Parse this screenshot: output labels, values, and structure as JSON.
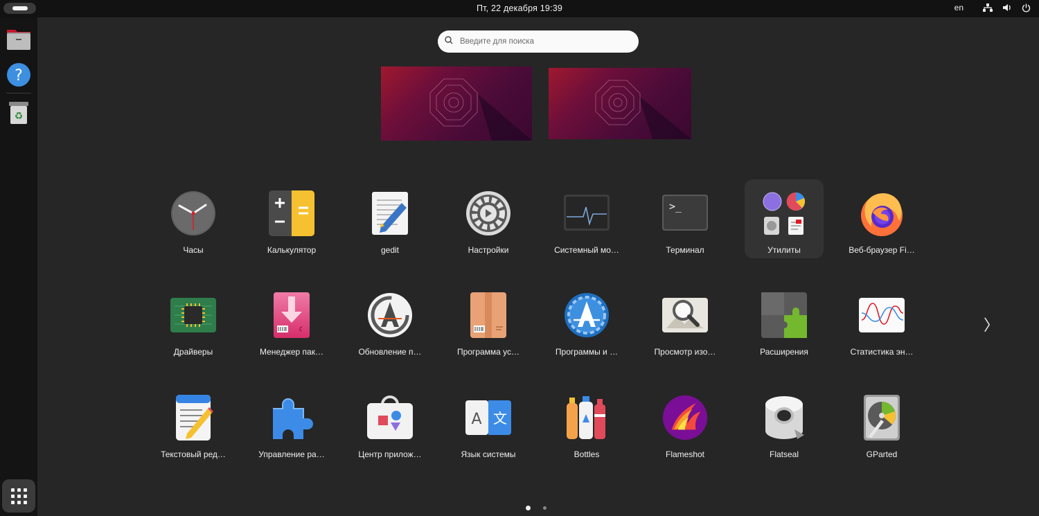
{
  "topbar": {
    "datetime": "Пт, 22 декабря  19:39",
    "lang": "en"
  },
  "search": {
    "placeholder": "Введите для поиска"
  },
  "apps": [
    {
      "label": "Часы",
      "icon": "clock-icon"
    },
    {
      "label": "Калькулятор",
      "icon": "calculator-icon"
    },
    {
      "label": "gedit",
      "icon": "gedit-icon"
    },
    {
      "label": "Настройки",
      "icon": "settings-gear-icon"
    },
    {
      "label": "Системный мо…",
      "icon": "system-monitor-icon"
    },
    {
      "label": "Терминал",
      "icon": "terminal-icon"
    },
    {
      "label": "Утилиты",
      "icon": "utilities-folder-icon"
    },
    {
      "label": "Веб-браузер Fi…",
      "icon": "firefox-icon"
    },
    {
      "label": "Драйверы",
      "icon": "drivers-chip-icon"
    },
    {
      "label": "Менеджер пак…",
      "icon": "package-manager-icon"
    },
    {
      "label": "Обновление п…",
      "icon": "software-updater-icon"
    },
    {
      "label": "Программа ус…",
      "icon": "package-installer-icon"
    },
    {
      "label": "Программы и …",
      "icon": "software-sources-icon"
    },
    {
      "label": "Просмотр изо…",
      "icon": "image-viewer-icon"
    },
    {
      "label": "Расширения",
      "icon": "extensions-icon"
    },
    {
      "label": "Статистика эн…",
      "icon": "power-statistics-icon"
    },
    {
      "label": "Текстовый ред…",
      "icon": "text-editor-icon"
    },
    {
      "label": "Управление ра…",
      "icon": "extension-manager-icon"
    },
    {
      "label": "Центр прилож…",
      "icon": "app-center-icon"
    },
    {
      "label": "Язык системы",
      "icon": "language-icon"
    },
    {
      "label": "Bottles",
      "icon": "bottles-icon"
    },
    {
      "label": "Flameshot",
      "icon": "flameshot-icon"
    },
    {
      "label": "Flatseal",
      "icon": "flatseal-icon"
    },
    {
      "label": "GParted",
      "icon": "gparted-icon"
    }
  ],
  "pagination": {
    "current_page": 1,
    "total_pages": 2
  },
  "colors": {
    "wallpaper": "#6d0f3a",
    "accent": "#e95420"
  }
}
